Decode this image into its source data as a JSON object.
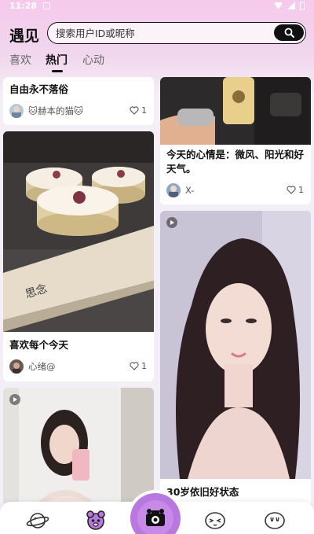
{
  "status_bar": {
    "time": "11:28"
  },
  "header": {
    "title": "遇见",
    "search": {
      "placeholder": "搜索用户ID或昵称",
      "icon": "search-icon"
    }
  },
  "tabs": [
    {
      "label": "喜欢",
      "active": false
    },
    {
      "label": "热门",
      "active": true
    },
    {
      "label": "心动",
      "active": false
    }
  ],
  "feed": {
    "left": [
      {
        "title": "自由永不落俗",
        "author": "🐱赫本的猫🐱",
        "likes": "1"
      },
      {
        "title": "喜欢每个今天",
        "author": "心绪@",
        "likes": "1"
      },
      {
        "title": "",
        "author": "",
        "likes": "",
        "video": true
      }
    ],
    "right": [
      {
        "title": "今天的心情是：微风、阳光和好天气。",
        "author": "X-",
        "likes": "1"
      },
      {
        "title": "30岁依旧好状态",
        "author": "",
        "likes": "",
        "video": true
      }
    ]
  },
  "bottom_nav": [
    {
      "icon": "planet-icon"
    },
    {
      "icon": "mascot-icon",
      "active": true
    },
    {
      "icon": "camera-icon",
      "center": true
    },
    {
      "icon": "chat-face-icon"
    },
    {
      "icon": "profile-face-icon"
    }
  ],
  "colors": {
    "accent": "#b878e0",
    "header_gradient_top": "#f6c9ec"
  }
}
